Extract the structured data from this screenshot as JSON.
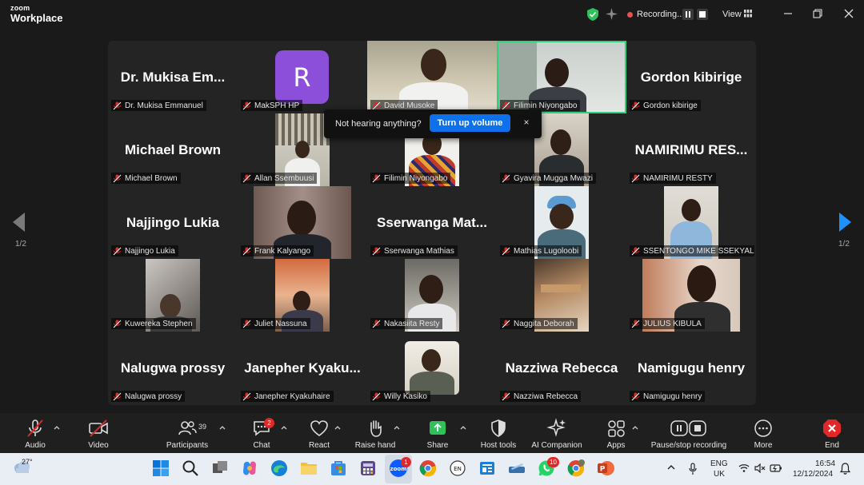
{
  "app": {
    "logo_line1": "zoom",
    "logo_line2": "Workplace"
  },
  "topbar": {
    "recording_text": "Recording...",
    "view_label": "View"
  },
  "toast": {
    "text": "Not hearing anything?",
    "button": "Turn up volume",
    "close": "×"
  },
  "pagination": {
    "left": "1/2",
    "right": "1/2"
  },
  "tiles": [
    {
      "label": "Dr. Mukisa Emmanuel",
      "big": "Dr. Mukisa Em...",
      "video": false
    },
    {
      "label": "MakSPH HP",
      "avatar": "R",
      "video": false
    },
    {
      "label": "David Musoke",
      "video": true
    },
    {
      "label": "Filimin Niyongabo",
      "video": true
    },
    {
      "label": "Gordon kibirige",
      "big": "Gordon kibirige",
      "video": false
    },
    {
      "label": "Michael Brown",
      "big": "Michael Brown",
      "video": false
    },
    {
      "label": "Allan Ssembuusi",
      "video": true
    },
    {
      "label": "Filimin Niyongabo",
      "video": true
    },
    {
      "label": "Gyavira Mugga Mwazi",
      "video": true
    },
    {
      "label": "NAMIRIMU RESTY",
      "big": "NAMIRIMU  RES...",
      "video": false
    },
    {
      "label": "Najjingo Lukia",
      "big": "Najjingo Lukia",
      "video": false
    },
    {
      "label": "Frank Kalyango",
      "video": true
    },
    {
      "label": "Sserwanga Mathias",
      "big": "Sserwanga  Mat...",
      "video": false
    },
    {
      "label": "Mathias Lugoloobi",
      "video": true
    },
    {
      "label": "SSENTONGO MIKE SSEKYALO",
      "video": true
    },
    {
      "label": "Kuwereka Stephen",
      "video": true
    },
    {
      "label": "Juliet Nassuna",
      "video": true
    },
    {
      "label": "Nakasiita Resty",
      "video": true
    },
    {
      "label": "Naggita Deborah",
      "video": true
    },
    {
      "label": "JULIUS KIBULA",
      "video": true
    },
    {
      "label": "Nalugwa prossy",
      "big": "Nalugwa prossy",
      "video": false
    },
    {
      "label": "Janepher Kyakuhaire",
      "big": "Janepher  Kyaku...",
      "video": false
    },
    {
      "label": "Willy Kasiko",
      "video": true
    },
    {
      "label": "Nazziwa Rebecca",
      "big": "Nazziwa Rebecca",
      "video": false
    },
    {
      "label": "Namigugu henry",
      "big": "Namigugu henry",
      "video": false
    }
  ],
  "toolbar": {
    "audio": "Audio",
    "video": "Video",
    "participants": "Participants",
    "participants_count": "39",
    "chat": "Chat",
    "chat_badge": "2",
    "react": "React",
    "raise_hand": "Raise hand",
    "share": "Share",
    "host_tools": "Host tools",
    "ai_companion": "AI Companion",
    "apps": "Apps",
    "pause_recording": "Pause/stop recording",
    "more": "More",
    "end": "End"
  },
  "taskbar": {
    "temperature": "27°",
    "zoom_badge": "1",
    "whatsapp_badge": "10",
    "lang_top": "ENG",
    "lang_bottom": "UK",
    "time": "16:54",
    "date": "12/12/2024"
  },
  "colors": {
    "accent_blue": "#0e71eb",
    "active_speaker": "#2fd27a",
    "recording_red": "#e5534b",
    "end_red": "#e02828"
  }
}
